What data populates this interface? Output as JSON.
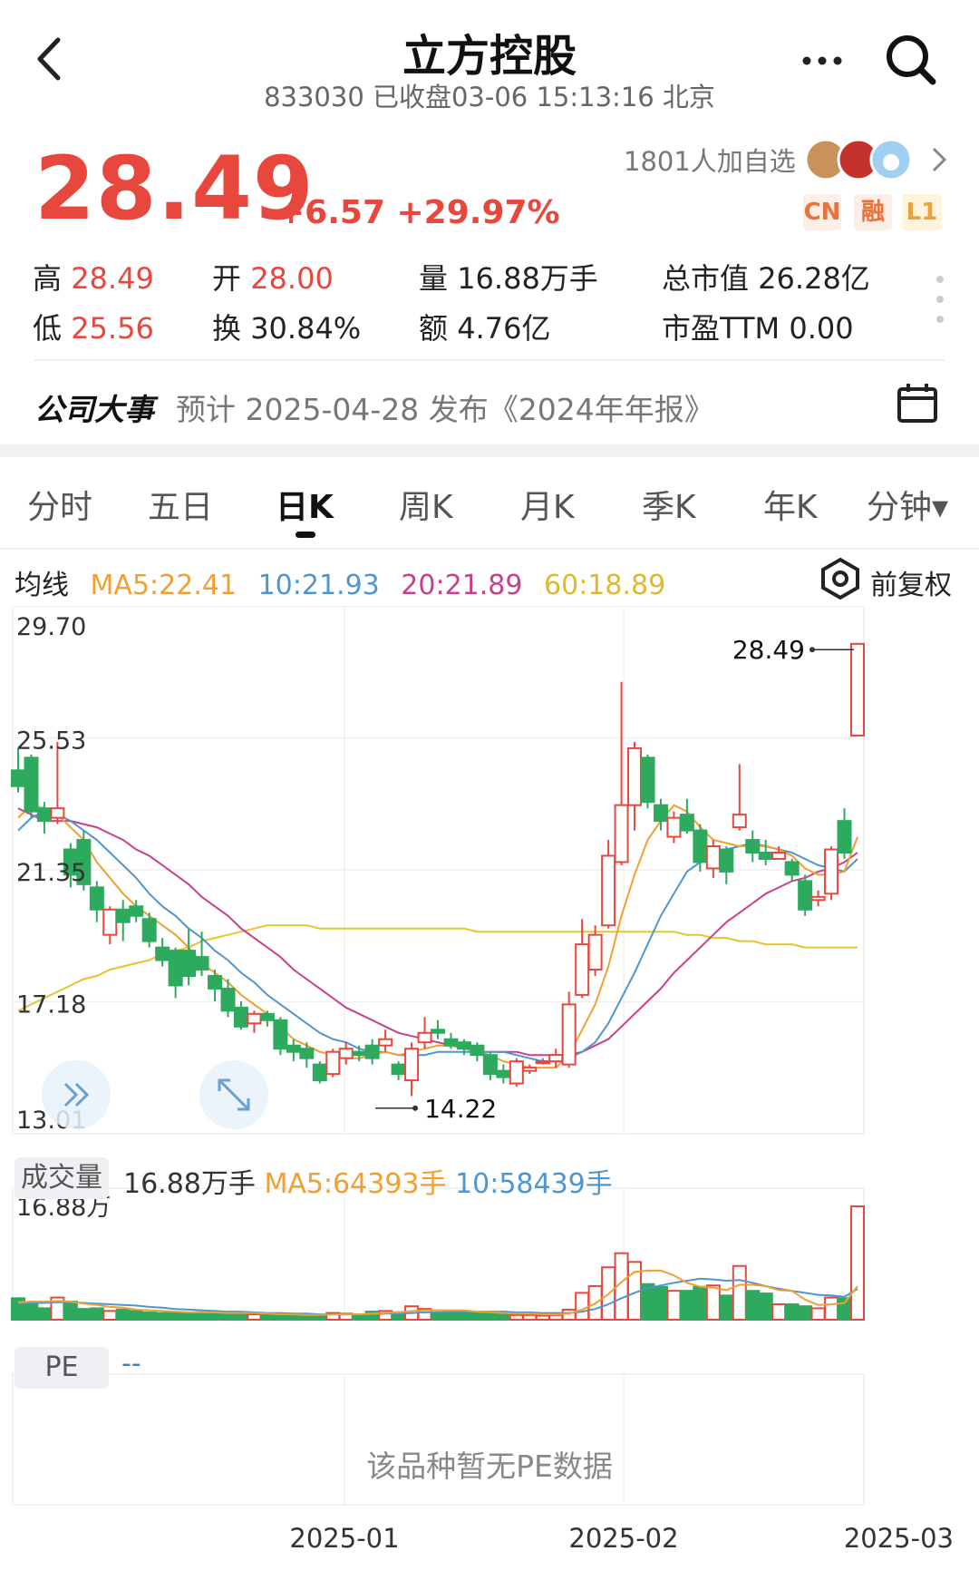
{
  "header": {
    "title": "立方控股",
    "subtitle": "833030 已收盘03-06 15:13:16 北京"
  },
  "quote": {
    "price": "28.49",
    "change": "+6.57 +29.97%",
    "watchers": "1801人加自选",
    "tags": [
      "CN",
      "融",
      "L1"
    ],
    "stats": {
      "high_label": "高",
      "high": "28.49",
      "open_label": "开",
      "open": "28.00",
      "volume_label": "量",
      "volume": "16.88万手",
      "mktcap_label": "总市值",
      "mktcap": "26.28亿",
      "low_label": "低",
      "low": "25.56",
      "turnover_label": "换",
      "turnover": "30.84%",
      "amount_label": "额",
      "amount": "4.76亿",
      "pe_label": "市盈TTM",
      "pe": "0.00"
    }
  },
  "event": {
    "title": "公司大事",
    "text": "预计 2025-04-28 发布《2024年年报》"
  },
  "tabs": [
    "分时",
    "五日",
    "日K",
    "周K",
    "月K",
    "季K",
    "年K",
    "分钟▾"
  ],
  "active_tab": "日K",
  "ma_legend": {
    "label": "均线",
    "ma5": "MA5:22.41",
    "ma10": "10:21.93",
    "ma20": "20:21.89",
    "ma60": "60:18.89"
  },
  "adjust_label": "前复权",
  "volume_panel": {
    "label": "成交量",
    "value": "16.88万手",
    "ma5": "MA5:64393手",
    "ma10": "10:58439手",
    "axis_max_label": "16.88万"
  },
  "pe_panel": {
    "label": "PE",
    "value": "--",
    "empty_text": "该品种暂无PE数据"
  },
  "colors": {
    "up": "#e8473d",
    "down": "#2daa5e",
    "ma5": "#f0a030",
    "ma10": "#4d96d0",
    "ma20": "#c8408a",
    "ma60": "#e5c430"
  },
  "chart_data": {
    "type": "candlestick",
    "y_ticks": [
      "29.70",
      "25.53",
      "21.35",
      "17.18",
      "13.01"
    ],
    "ylim": [
      13.01,
      29.7
    ],
    "x_labels": [
      "2025-01",
      "2025-02",
      "2025-03"
    ],
    "max_label": "28.49",
    "min_label": "14.22",
    "candles": [
      [
        24.5,
        24.0,
        25.2,
        23.8
      ],
      [
        24.9,
        23.2,
        25.0,
        23.0
      ],
      [
        23.3,
        22.9,
        23.5,
        22.5
      ],
      [
        23.0,
        23.3,
        25.4,
        22.8
      ],
      [
        22.0,
        21.2,
        22.2,
        20.8
      ],
      [
        22.3,
        20.9,
        22.6,
        20.7
      ],
      [
        20.8,
        20.1,
        21.0,
        19.7
      ],
      [
        19.3,
        20.1,
        20.2,
        19.0
      ],
      [
        20.1,
        19.7,
        20.4,
        19.1
      ],
      [
        20.2,
        19.9,
        20.4,
        19.7
      ],
      [
        19.8,
        19.1,
        20.0,
        18.9
      ],
      [
        18.9,
        18.5,
        19.2,
        18.3
      ],
      [
        18.8,
        17.7,
        18.9,
        17.3
      ],
      [
        18.8,
        18.0,
        19.5,
        17.7
      ],
      [
        18.6,
        18.2,
        19.4,
        18.0
      ],
      [
        18.0,
        17.6,
        18.2,
        17.2
      ],
      [
        17.6,
        16.9,
        17.9,
        16.7
      ],
      [
        17.0,
        16.4,
        17.2,
        16.3
      ],
      [
        16.5,
        16.8,
        16.9,
        16.2
      ],
      [
        16.8,
        16.6,
        16.9,
        16.4
      ],
      [
        16.6,
        15.7,
        16.7,
        15.5
      ],
      [
        15.8,
        15.6,
        16.0,
        15.3
      ],
      [
        15.7,
        15.4,
        15.9,
        15.1
      ],
      [
        15.2,
        14.7,
        15.3,
        14.6
      ],
      [
        14.9,
        15.6,
        15.7,
        14.8
      ],
      [
        15.4,
        15.7,
        15.9,
        15.2
      ],
      [
        15.6,
        15.5,
        15.8,
        15.3
      ],
      [
        15.8,
        15.4,
        16.0,
        15.2
      ],
      [
        15.8,
        16.0,
        16.3,
        15.6
      ],
      [
        15.2,
        14.9,
        15.3,
        14.7
      ],
      [
        14.7,
        15.7,
        15.9,
        14.2
      ],
      [
        15.9,
        16.2,
        16.7,
        15.7
      ],
      [
        16.3,
        16.2,
        16.6,
        16.0
      ],
      [
        16.0,
        15.8,
        16.2,
        15.7
      ],
      [
        15.9,
        15.7,
        16.0,
        15.5
      ],
      [
        15.8,
        15.5,
        15.9,
        15.3
      ],
      [
        15.5,
        14.9,
        15.6,
        14.7
      ],
      [
        15.0,
        14.8,
        15.2,
        14.6
      ],
      [
        14.6,
        15.3,
        15.4,
        14.5
      ],
      [
        15.0,
        15.1,
        15.2,
        14.9
      ],
      [
        15.3,
        15.3,
        15.4,
        15.2
      ],
      [
        15.3,
        15.5,
        15.7,
        15.1
      ],
      [
        15.2,
        17.1,
        17.5,
        15.1
      ],
      [
        17.4,
        19.0,
        19.8,
        17.3
      ],
      [
        18.2,
        19.3,
        19.6,
        18.0
      ],
      [
        19.6,
        21.8,
        22.3,
        19.5
      ],
      [
        21.6,
        23.4,
        27.3,
        21.5
      ],
      [
        23.4,
        25.2,
        25.4,
        22.6
      ],
      [
        24.9,
        23.5,
        25.0,
        23.3
      ],
      [
        23.4,
        22.9,
        23.6,
        22.6
      ],
      [
        22.4,
        23.0,
        23.2,
        22.2
      ],
      [
        23.1,
        22.6,
        23.6,
        22.5
      ],
      [
        22.6,
        21.6,
        22.8,
        21.3
      ],
      [
        21.4,
        22.1,
        22.3,
        21.1
      ],
      [
        22.0,
        21.3,
        22.1,
        20.9
      ],
      [
        22.7,
        23.1,
        24.7,
        22.6
      ],
      [
        22.3,
        21.9,
        22.6,
        21.6
      ],
      [
        21.9,
        21.7,
        22.3,
        21.5
      ],
      [
        21.7,
        21.9,
        22.1,
        21.7
      ],
      [
        21.6,
        21.2,
        21.7,
        21.0
      ],
      [
        21.0,
        20.1,
        21.2,
        19.9
      ],
      [
        20.4,
        20.5,
        20.7,
        20.2
      ],
      [
        20.6,
        22.0,
        22.1,
        20.4
      ],
      [
        22.9,
        21.9,
        23.3,
        21.7
      ],
      [
        25.6,
        28.5,
        28.5,
        25.6
      ]
    ],
    "ma5": [
      23.0,
      23.4,
      23.3,
      23.1,
      22.7,
      22.3,
      21.6,
      21.1,
      20.6,
      20.2,
      19.9,
      19.6,
      19.3,
      18.9,
      18.4,
      18.1,
      17.8,
      17.4,
      17.1,
      16.8,
      16.4,
      16.0,
      15.8,
      15.6,
      15.5,
      15.4,
      15.4,
      15.5,
      15.6,
      15.5,
      15.6,
      15.7,
      15.8,
      15.8,
      15.7,
      15.6,
      15.5,
      15.3,
      15.2,
      15.1,
      15.1,
      15.1,
      15.5,
      16.3,
      17.1,
      18.3,
      19.9,
      21.2,
      22.3,
      22.9,
      23.4,
      23.2,
      22.7,
      22.3,
      22.2,
      22.1,
      22.1,
      22.1,
      22.0,
      21.8,
      21.4,
      21.2,
      21.2,
      21.3,
      22.4
    ],
    "ma10": [
      22.6,
      23.0,
      23.2,
      23.1,
      22.9,
      22.6,
      22.3,
      21.9,
      21.5,
      21.1,
      20.6,
      20.2,
      19.9,
      19.5,
      19.2,
      18.8,
      18.5,
      18.1,
      17.8,
      17.4,
      17.1,
      16.8,
      16.5,
      16.2,
      16.0,
      15.9,
      15.7,
      15.6,
      15.6,
      15.5,
      15.5,
      15.5,
      15.6,
      15.6,
      15.6,
      15.6,
      15.6,
      15.6,
      15.5,
      15.4,
      15.3,
      15.3,
      15.4,
      15.6,
      15.9,
      16.5,
      17.3,
      18.1,
      19.0,
      19.9,
      20.6,
      21.3,
      21.6,
      21.8,
      22.0,
      22.1,
      22.2,
      22.1,
      22.0,
      21.9,
      21.7,
      21.5,
      21.4,
      21.3,
      21.7
    ],
    "ma20": [
      23.3,
      23.1,
      22.9,
      22.9,
      22.9,
      22.8,
      22.7,
      22.5,
      22.3,
      22.0,
      21.8,
      21.5,
      21.2,
      20.9,
      20.5,
      20.2,
      19.9,
      19.5,
      19.2,
      18.9,
      18.6,
      18.2,
      17.9,
      17.6,
      17.3,
      17.0,
      16.8,
      16.6,
      16.4,
      16.2,
      16.1,
      16.0,
      15.9,
      15.8,
      15.7,
      15.6,
      15.6,
      15.6,
      15.6,
      15.5,
      15.5,
      15.5,
      15.5,
      15.6,
      15.8,
      16.0,
      16.4,
      16.8,
      17.2,
      17.6,
      18.1,
      18.5,
      18.9,
      19.3,
      19.7,
      20.0,
      20.3,
      20.6,
      20.8,
      21.0,
      21.1,
      21.3,
      21.4,
      21.6,
      21.9
    ],
    "ma60": [
      16.9,
      17.1,
      17.3,
      17.5,
      17.7,
      17.9,
      18.0,
      18.2,
      18.3,
      18.4,
      18.5,
      18.7,
      18.8,
      18.9,
      19.1,
      19.2,
      19.3,
      19.4,
      19.5,
      19.6,
      19.6,
      19.6,
      19.6,
      19.5,
      19.5,
      19.5,
      19.5,
      19.5,
      19.5,
      19.5,
      19.5,
      19.5,
      19.5,
      19.5,
      19.5,
      19.4,
      19.4,
      19.4,
      19.4,
      19.4,
      19.4,
      19.4,
      19.4,
      19.4,
      19.4,
      19.4,
      19.4,
      19.4,
      19.4,
      19.4,
      19.4,
      19.3,
      19.3,
      19.2,
      19.2,
      19.1,
      19.1,
      19.0,
      19.0,
      19.0,
      18.9,
      18.9,
      18.9,
      18.9,
      18.9
    ],
    "volume": [
      3.2,
      2.5,
      1.7,
      3.3,
      2.7,
      1.6,
      1.7,
      1.3,
      1.5,
      1.3,
      1.1,
      1.0,
      1.1,
      1.0,
      1.1,
      1.2,
      0.9,
      0.9,
      0.8,
      0.8,
      0.7,
      0.7,
      0.6,
      0.6,
      1.0,
      0.9,
      0.7,
      1.2,
      1.3,
      1.1,
      2.0,
      1.6,
      1.1,
      1.1,
      1.0,
      1.0,
      1.0,
      0.9,
      0.7,
      0.7,
      0.6,
      0.7,
      1.5,
      4.0,
      5.0,
      7.8,
      9.9,
      8.6,
      5.3,
      4.9,
      4.3,
      4.3,
      4.9,
      5.1,
      3.6,
      8.0,
      4.3,
      3.9,
      2.3,
      2.3,
      2.0,
      1.7,
      3.3,
      3.2,
      16.88
    ],
    "vol_max": 16.88,
    "vol_ma5": [
      2.6,
      2.7,
      2.7,
      2.8,
      2.7,
      2.4,
      2.2,
      1.9,
      1.8,
      1.5,
      1.4,
      1.3,
      1.2,
      1.1,
      1.1,
      1.1,
      1.0,
      1.0,
      1.0,
      0.9,
      0.8,
      0.8,
      0.7,
      0.7,
      0.8,
      0.8,
      0.8,
      0.9,
      1.0,
      1.1,
      1.3,
      1.4,
      1.4,
      1.4,
      1.4,
      1.2,
      1.1,
      1.0,
      0.9,
      0.9,
      0.8,
      0.8,
      0.9,
      1.5,
      2.4,
      3.8,
      5.6,
      7.1,
      7.3,
      7.3,
      6.6,
      5.5,
      4.9,
      4.8,
      4.4,
      5.2,
      5.2,
      5.0,
      4.4,
      4.3,
      3.0,
      2.2,
      2.3,
      2.5,
      5.0
    ],
    "vol_ma10": [
      2.4,
      2.5,
      2.5,
      2.6,
      2.6,
      2.5,
      2.4,
      2.3,
      2.2,
      2.1,
      1.9,
      1.8,
      1.6,
      1.5,
      1.4,
      1.3,
      1.2,
      1.2,
      1.1,
      1.0,
      1.0,
      0.9,
      0.9,
      0.8,
      0.8,
      0.8,
      0.8,
      0.8,
      0.9,
      0.9,
      1.0,
      1.1,
      1.1,
      1.2,
      1.2,
      1.2,
      1.2,
      1.2,
      1.1,
      1.1,
      1.0,
      1.0,
      1.0,
      1.2,
      1.6,
      2.3,
      3.2,
      4.0,
      4.7,
      5.1,
      5.5,
      5.8,
      6.1,
      6.0,
      5.8,
      5.9,
      5.5,
      5.0,
      4.6,
      4.3,
      4.0,
      3.7,
      3.6,
      3.4,
      4.6
    ]
  }
}
